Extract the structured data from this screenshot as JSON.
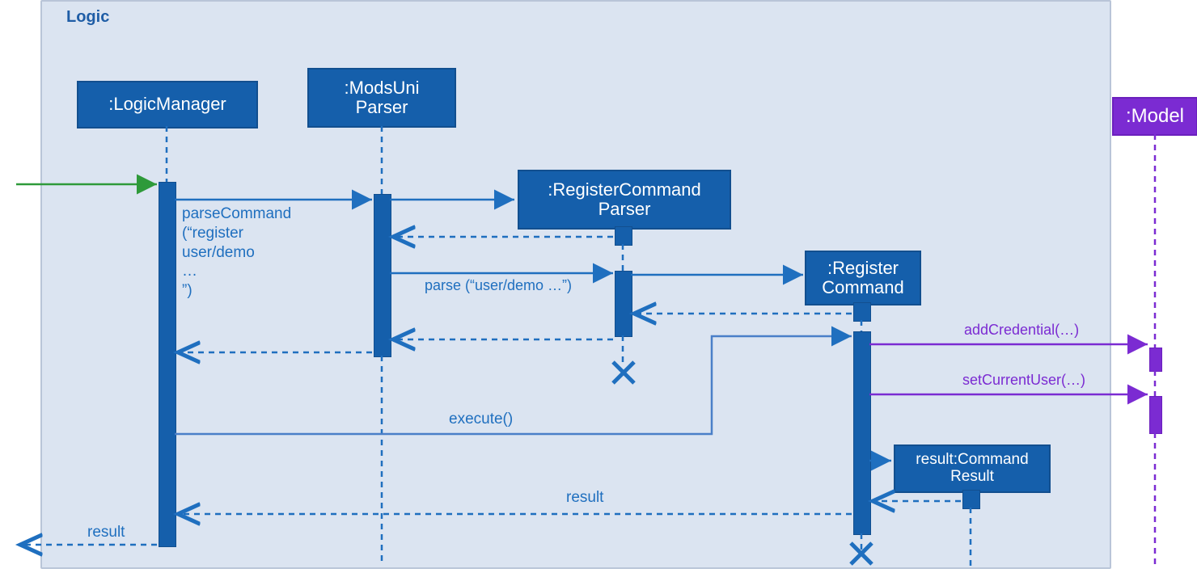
{
  "frame": {
    "label": "Logic"
  },
  "participants": {
    "logicManager": ":LogicManager",
    "modsUniParser": ":ModsUni\nParser",
    "registerCommandParser": ":RegisterCommand\nParser",
    "registerCommand": ":Register\nCommand",
    "commandResult": "result:Command\nResult",
    "model": ":Model"
  },
  "messages": {
    "parseCommand": "parseCommand\n(“register\nuser/demo\n…\n”)",
    "parse": "parse (“user/demo …”)",
    "execute": "execute()",
    "addCredential": "addCredential(…)",
    "setCurrentUser": "setCurrentUser(…)",
    "result": "result",
    "resultOut": "result"
  }
}
